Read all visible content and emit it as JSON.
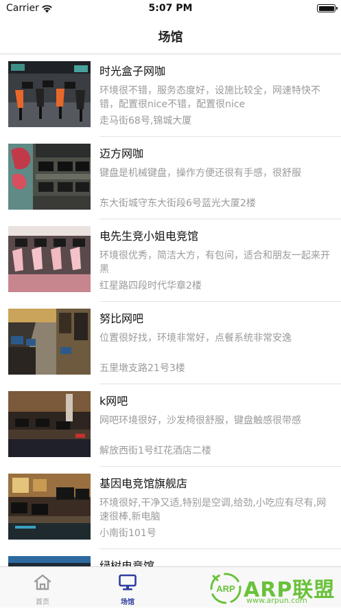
{
  "status": {
    "carrier": "Carrier",
    "time": "5:07 PM"
  },
  "nav": {
    "title": "场馆"
  },
  "venues": [
    {
      "name": "时光盒子网咖",
      "desc": "环境很不错，服务态度好，设施比较全，网速特快不错，配置很nice不错，配置很nice",
      "addr": "走马街68号,锦城大厦"
    },
    {
      "name": "迈方网咖",
      "desc": "键盘是机械键盘，操作方便还很有手感，很舒服",
      "addr": "东大街城守东大街段6号蓝光大厦2楼"
    },
    {
      "name": "电先生竞小姐电竞馆",
      "desc": "环境很优秀，简洁大方，有包间，适合和朋友一起来开黑",
      "addr": "红星路四段时代华章2楼"
    },
    {
      "name": "努比网吧",
      "desc": "位置很好找，环境非常好，点餐系统非常安逸",
      "addr": "五里墩支路21号3楼"
    },
    {
      "name": "k网吧",
      "desc": "网吧环境很好，沙发椅很舒服，键盘触感很带感",
      "addr": "解放西街1号红花酒店二楼"
    },
    {
      "name": "基因电竞馆旗舰店",
      "desc": "环境很好,干净又适,特别是空调,给劲,小吃应有尽有,网速很棒,新电脑",
      "addr": "小南街101号"
    },
    {
      "name": "绿树电竞馆",
      "desc": "",
      "addr": ""
    }
  ],
  "tabs": {
    "home": "首页",
    "venue": "场馆"
  },
  "watermark": {
    "brand": "ARP联盟",
    "url": "www.arpun.com",
    "badge": "ARP"
  },
  "colors": {
    "accent": "#2f3da0",
    "watermark": "#69c23a",
    "text_gray": "#9a9a9a"
  }
}
